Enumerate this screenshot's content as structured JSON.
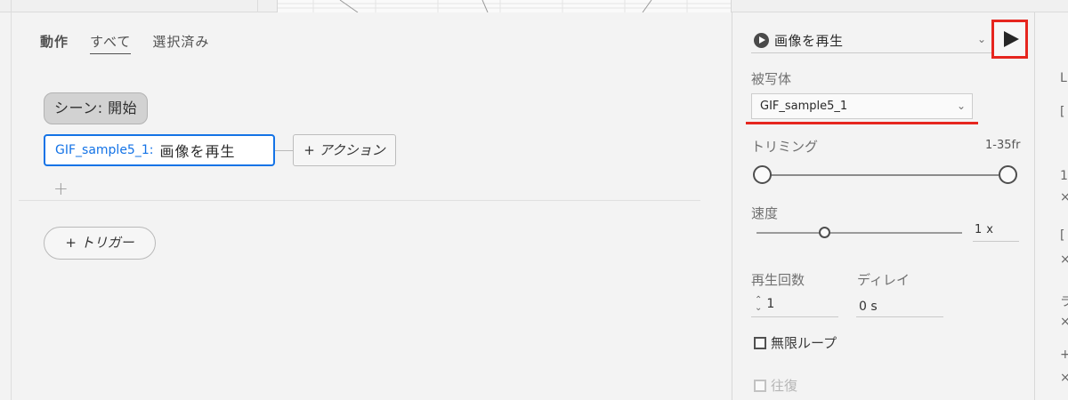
{
  "tabs": [
    {
      "label": "動作",
      "bold": true
    },
    {
      "label": "すべて",
      "active": true
    },
    {
      "label": "選択済み"
    }
  ],
  "scene": {
    "label": "シーン: 開始"
  },
  "action": {
    "target": "GIF_sample5_1",
    "separator": ":",
    "name": "画像を再生"
  },
  "add_action": {
    "label": "+ アクション"
  },
  "add_item": {
    "label": "+"
  },
  "trigger": {
    "label": "+ トリガー"
  },
  "properties": {
    "action_select": {
      "value": "画像を再生"
    },
    "subject": {
      "label": "被写体",
      "value": "GIF_sample5_1"
    },
    "trimming": {
      "label": "トリミング",
      "range": "1-35fr",
      "start_fraction": 0.0,
      "end_fraction": 1.0
    },
    "speed": {
      "label": "速度",
      "value": "1",
      "unit": "x",
      "fraction": 0.33
    },
    "repeat": {
      "label": "再生回数",
      "value": "1"
    },
    "delay": {
      "label": "ディレイ",
      "value": "0 s"
    },
    "infinite_loop": {
      "label": "無限ループ",
      "checked": false
    },
    "round_trip": {
      "label": "往復",
      "checked": false,
      "disabled": true
    }
  },
  "colors": {
    "highlight": "#e6261f",
    "accent": "#1473e6"
  },
  "icons": {
    "action_icon": "play-circle-icon",
    "chevron": "chevron-down-icon",
    "play": "play-icon",
    "stepper": "stepper-arrows-icon",
    "checkbox": "checkbox-icon"
  }
}
